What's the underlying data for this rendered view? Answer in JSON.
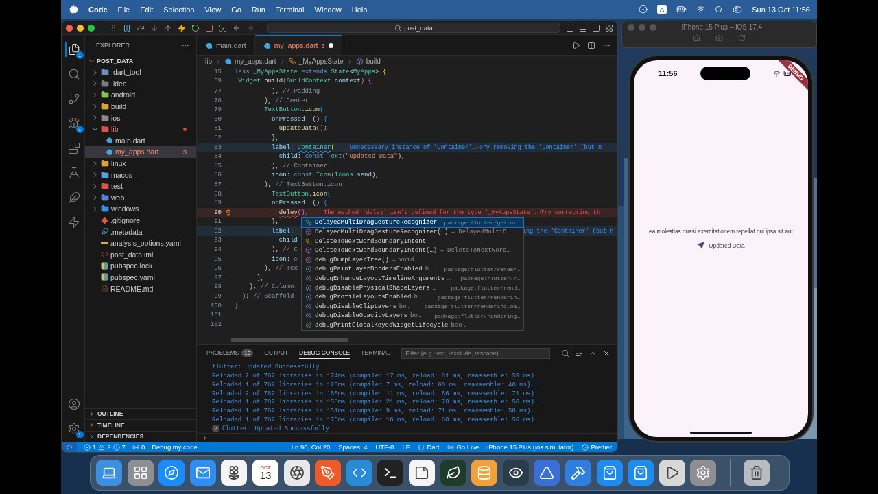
{
  "menubar": {
    "app_name": "Code",
    "menus": [
      "File",
      "Edit",
      "Selection",
      "View",
      "Go",
      "Run",
      "Terminal",
      "Window",
      "Help"
    ],
    "input_source": "A",
    "clock": "Sun 13 Oct 11:56"
  },
  "vscode": {
    "search": "post_data",
    "activity": [
      {
        "kind": "files",
        "badge": "1",
        "selected": true
      },
      {
        "kind": "search",
        "selected": false
      },
      {
        "kind": "source-control",
        "selected": false
      },
      {
        "kind": "run-debug",
        "badge": "1",
        "selected": false
      },
      {
        "kind": "extensions",
        "selected": false
      },
      {
        "kind": "testing",
        "selected": false
      },
      {
        "kind": "flutter",
        "selected": false
      },
      {
        "kind": "lightning",
        "selected": false
      }
    ],
    "activity_bottom": [
      {
        "kind": "account"
      },
      {
        "kind": "settings",
        "badge": "1"
      }
    ],
    "sidebar": {
      "title": "EXPLORER",
      "root": "POST_DATA",
      "tree": [
        {
          "label": ".dart_tool",
          "kind": "folder",
          "color": "#6d8fb3",
          "expanded": false,
          "selected": false
        },
        {
          "label": ".idea",
          "kind": "folder",
          "color": "#7b7b7b",
          "expanded": false,
          "selected": false
        },
        {
          "label": "android",
          "kind": "folder",
          "color": "#8bc34a",
          "expanded": false,
          "selected": false
        },
        {
          "label": "build",
          "kind": "folder",
          "color": "#e0a030",
          "expanded": false,
          "selected": false
        },
        {
          "label": "ios",
          "kind": "folder",
          "color": "#8a8a8a",
          "expanded": false,
          "selected": false
        },
        {
          "label": "lib",
          "kind": "folder",
          "color": "#e05050",
          "expanded": true,
          "error": true,
          "selected": false,
          "children": [
            {
              "label": "main.dart",
              "kind": "dart",
              "selected": false
            },
            {
              "label": "my_apps.dart",
              "kind": "dart",
              "error": true,
              "badge": "3",
              "selected": true
            }
          ]
        },
        {
          "label": "linux",
          "kind": "folder",
          "color": "#e0a030",
          "expanded": false,
          "selected": false
        },
        {
          "label": "macos",
          "kind": "folder",
          "color": "#5a9fd6",
          "expanded": false,
          "selected": false
        },
        {
          "label": "test",
          "kind": "folder",
          "color": "#e05050",
          "expanded": false,
          "selected": false
        },
        {
          "label": "web",
          "kind": "folder",
          "color": "#5a7fd6",
          "expanded": false,
          "selected": false
        },
        {
          "label": "windows",
          "kind": "folder",
          "color": "#3a8ee6",
          "expanded": false,
          "selected": false
        },
        {
          "label": ".gitignore",
          "kind": "git",
          "selected": false
        },
        {
          "label": ".metadata",
          "kind": "flutter",
          "selected": false
        },
        {
          "label": "analysis_options.yaml",
          "kind": "yaml",
          "selected": false
        },
        {
          "label": "post_data.iml",
          "kind": "xml",
          "selected": false
        },
        {
          "label": "pubspec.lock",
          "kind": "pubspec",
          "selected": false
        },
        {
          "label": "pubspec.yaml",
          "kind": "pubspec",
          "selected": false
        },
        {
          "label": "README.md",
          "kind": "markdown",
          "selected": false
        }
      ],
      "sections": [
        "OUTLINE",
        "TIMELINE",
        "DEPENDENCIES"
      ]
    },
    "editor": {
      "tabs": [
        {
          "label": "main.dart",
          "selected": false,
          "modified": false,
          "error": false
        },
        {
          "label": "my_apps.dart",
          "badge": "3",
          "selected": true,
          "modified": true,
          "error": true
        }
      ],
      "breadcrumb": [
        {
          "label": "lib",
          "kind": "folder"
        },
        {
          "label": "my_apps.dart",
          "kind": "dart"
        },
        {
          "label": "_MyAppsState",
          "kind": "class"
        },
        {
          "label": "build",
          "kind": "method"
        }
      ],
      "sticky_lines": [
        {
          "number": "15",
          "segments": [
            {
              "text": "lass",
              "kind": "kw"
            },
            {
              "text": " _MyAppsState ",
              "kind": "type"
            },
            {
              "text": "extends",
              "kind": "kw"
            },
            {
              "text": " State",
              "kind": "type"
            },
            {
              "text": "<",
              "kind": "plain"
            },
            {
              "text": "MyApps",
              "kind": "type"
            },
            {
              "text": "> ",
              "kind": "plain"
            },
            {
              "text": "{",
              "kind": "b1"
            }
          ]
        },
        {
          "number": "69",
          "segments": [
            {
              "text": " Widget ",
              "kind": "type"
            },
            {
              "text": "build",
              "kind": "fn"
            },
            {
              "text": "(",
              "kind": "b2"
            },
            {
              "text": "BuildContext ",
              "kind": "type"
            },
            {
              "text": "context",
              "kind": "prop"
            },
            {
              "text": ") {",
              "kind": "b2"
            }
          ]
        }
      ],
      "lines": [
        {
          "number": "77",
          "segments": [
            {
              "text": "          ), ",
              "kind": "plain"
            },
            {
              "text": "// Padding",
              "kind": "comment"
            }
          ]
        },
        {
          "number": "78",
          "segments": [
            {
              "text": "        ), ",
              "kind": "plain"
            },
            {
              "text": "// Center",
              "kind": "comment"
            }
          ]
        },
        {
          "number": "79",
          "segments": [
            {
              "text": "        TextButton",
              "kind": "type"
            },
            {
              "text": ".",
              "kind": "plain"
            },
            {
              "text": "icon",
              "kind": "fn"
            },
            {
              "text": "(",
              "kind": "b3"
            }
          ]
        },
        {
          "number": "80",
          "segments": [
            {
              "text": "          onPressed",
              "kind": "prop"
            },
            {
              "text": ": () ",
              "kind": "plain"
            },
            {
              "text": "{",
              "kind": "b3"
            }
          ]
        },
        {
          "number": "81",
          "segments": [
            {
              "text": "            updateData",
              "kind": "fn"
            },
            {
              "text": "()",
              "kind": "b2"
            },
            {
              "text": ";",
              "kind": "plain"
            }
          ]
        },
        {
          "number": "82",
          "segments": [
            {
              "text": "          },",
              "kind": "plain"
            }
          ]
        },
        {
          "number": "83",
          "segments": [
            {
              "text": "          label",
              "kind": "prop"
            },
            {
              "text": ": ",
              "kind": "plain"
            },
            {
              "text": "Container",
              "kind": "info_type"
            },
            {
              "text": "(",
              "kind": "b1"
            }
          ],
          "diagnostic": {
            "error": false,
            "text": "Unnecessary instance of 'Container'.↵Try removing the 'Container' (but n",
            "continued": false
          }
        },
        {
          "number": "84",
          "segments": [
            {
              "text": "            child",
              "kind": "prop"
            },
            {
              "text": ": ",
              "kind": "plain"
            },
            {
              "text": "const ",
              "kind": "kw"
            },
            {
              "text": "Text",
              "kind": "type"
            },
            {
              "text": "(",
              "kind": "b2"
            },
            {
              "text": "\"Updated Data\"",
              "kind": "str"
            },
            {
              "text": "),",
              "kind": "plain"
            }
          ]
        },
        {
          "number": "85",
          "segments": [
            {
              "text": "          ), ",
              "kind": "plain"
            },
            {
              "text": "// Container",
              "kind": "comment"
            }
          ]
        },
        {
          "number": "86",
          "segments": [
            {
              "text": "          icon",
              "kind": "prop"
            },
            {
              "text": ": ",
              "kind": "plain"
            },
            {
              "text": "const ",
              "kind": "kw"
            },
            {
              "text": "Icon",
              "kind": "type"
            },
            {
              "text": "(",
              "kind": "b2"
            },
            {
              "text": "Icons",
              "kind": "type"
            },
            {
              "text": ".",
              "kind": "plain"
            },
            {
              "text": "send",
              "kind": "prop"
            },
            {
              "text": "),",
              "kind": "plain"
            }
          ]
        },
        {
          "number": "87",
          "segments": [
            {
              "text": "        ), ",
              "kind": "plain"
            },
            {
              "text": "// TextButton.icon",
              "kind": "comment"
            }
          ]
        },
        {
          "number": "88",
          "segments": [
            {
              "text": "          TextButton",
              "kind": "type"
            },
            {
              "text": ".",
              "kind": "plain"
            },
            {
              "text": "icon",
              "kind": "fn"
            },
            {
              "text": "(",
              "kind": "b3"
            }
          ]
        },
        {
          "number": "89",
          "segments": [
            {
              "text": "          onPressed",
              "kind": "prop"
            },
            {
              "text": ": () ",
              "kind": "plain"
            },
            {
              "text": "{",
              "kind": "b3"
            }
          ]
        },
        {
          "number": "90",
          "lightbulb": true,
          "current": true,
          "segments": [
            {
              "text": "            deley",
              "kind": "error_fn"
            },
            {
              "text": "()",
              "kind": "b2"
            },
            {
              "text": ";",
              "kind": "plain"
            }
          ],
          "diagnostic": {
            "error": true,
            "text": "The method 'deley' isn't defined for the type '_MyAppsState'.↵Try correcting th",
            "continued": false
          }
        },
        {
          "number": "91",
          "segments": [
            {
              "text": "          },",
              "kind": "plain"
            }
          ]
        },
        {
          "number": "92",
          "segments": [
            {
              "text": "          label",
              "kind": "prop"
            },
            {
              "text": ": ",
              "kind": "plain"
            }
          ],
          "diagnostic": {
            "error": false,
            "text": "ing the 'Container' (but n",
            "continued": true
          }
        },
        {
          "number": "93",
          "segments": [
            {
              "text": "            child",
              "kind": "prop"
            }
          ]
        },
        {
          "number": "94",
          "segments": [
            {
              "text": "          ), ",
              "kind": "plain"
            },
            {
              "text": "// C",
              "kind": "comment"
            }
          ]
        },
        {
          "number": "95",
          "segments": [
            {
              "text": "          icon",
              "kind": "prop"
            },
            {
              "text": ": ",
              "kind": "plain"
            },
            {
              "text": "c",
              "kind": "kw"
            }
          ]
        },
        {
          "number": "96",
          "segments": [
            {
              "text": "        ), ",
              "kind": "plain"
            },
            {
              "text": "// Tex",
              "kind": "comment"
            }
          ]
        },
        {
          "number": "97",
          "segments": [
            {
              "text": "      ],",
              "kind": "plain"
            }
          ]
        },
        {
          "number": "98",
          "segments": [
            {
              "text": "    ), ",
              "kind": "plain"
            },
            {
              "text": "// Column",
              "kind": "comment"
            }
          ]
        },
        {
          "number": "99",
          "segments": [
            {
              "text": "  ); ",
              "kind": "plain"
            },
            {
              "text": "// Scaffold",
              "kind": "comment"
            }
          ]
        },
        {
          "number": "100",
          "segments": [
            {
              "text": "}",
              "kind": "b2"
            }
          ]
        },
        {
          "number": "101"
        },
        {
          "number": "102"
        }
      ],
      "suggestions": [
        {
          "kind": "class",
          "label": "DelayedMultiDragGestureRecognizer",
          "source": "package:flutter/gestur…",
          "selected": true
        },
        {
          "kind": "method",
          "label": "DelayedMultiDragGestureRecognizer(…)",
          "type": "→ DelayedMultiD…",
          "selected": false
        },
        {
          "kind": "class",
          "label": "DeleteToNextWordBoundaryIntent",
          "selected": false
        },
        {
          "kind": "method",
          "label": "DeleteToNextWordBoundaryIntent(…)",
          "type": "→ DeleteToNextWord…",
          "selected": false
        },
        {
          "kind": "method",
          "label": "debugDumpLayerTree()",
          "type": "→ void",
          "selected": false
        },
        {
          "kind": "field",
          "label": "debugPaintLayerBordersEnabled",
          "type": "b…",
          "source": "package:flutter/render…",
          "selected": false
        },
        {
          "kind": "field",
          "label": "debugEnhanceLayoutTimelineArguments",
          "type": "…",
          "source": "package:flutter/r…",
          "selected": false
        },
        {
          "kind": "field",
          "label": "debugDisablePhysicalShapeLayers",
          "type": "…",
          "source": "package:flutter/rend…",
          "selected": false
        },
        {
          "kind": "field",
          "label": "debugProfileLayoutsEnabled",
          "type": "b…",
          "source": "package:flutter/renderin…",
          "selected": false
        },
        {
          "kind": "field",
          "label": "debugDisableClipLayers",
          "type": "bo…",
          "source": "package:flutter/rendering.da…",
          "selected": false
        },
        {
          "kind": "field",
          "label": "debugDisableOpacityLayers",
          "type": "bo…",
          "source": "package:flutter/rendering…",
          "selected": false
        },
        {
          "kind": "field",
          "label": "debugPrintGlobalKeyedWidgetLifecycle",
          "type": "bool",
          "selected": false
        }
      ]
    },
    "panel": {
      "tabs": [
        {
          "label": "PROBLEMS",
          "badge": "10",
          "selected": false
        },
        {
          "label": "OUTPUT",
          "selected": false
        },
        {
          "label": "DEBUG CONSOLE",
          "selected": true
        },
        {
          "label": "TERMINAL",
          "selected": false
        }
      ],
      "filter_placeholder": "Filter (e.g. text, !exclude, \\escape)",
      "console": [
        {
          "text": "flutter: Updated Successfully"
        },
        {
          "text": "Reloaded 2 of 782 libraries in 174ms (compile: 17 ms, reload: 81 ms, reassemble: 59 ms)."
        },
        {
          "text": "Reloaded 1 of 782 libraries in 126ms (compile: 7 ms, reload: 60 ms, reassemble: 48 ms)."
        },
        {
          "text": "Reloaded 2 of 782 libraries in 160ms (compile: 11 ms, reload: 66 ms, reassemble: 71 ms)."
        },
        {
          "text": "Reloaded 1 of 782 libraries in 158ms (compile: 21 ms, reload: 70 ms, reassemble: 56 ms)."
        },
        {
          "text": "Reloaded 1 of 782 libraries in 151ms (compile: 9 ms, reload: 71 ms, reassemble: 58 ms)."
        },
        {
          "text": "Reloaded 1 of 782 libraries in 175ms (compile: 16 ms, reload: 80 ms, reassemble: 56 ms)."
        },
        {
          "text": "flutter: Updated Successfully",
          "count": "2"
        }
      ]
    },
    "status_bar": {
      "errors": "1",
      "warnings": "2",
      "infos": "7",
      "ports": "0",
      "debug": "Debug my code",
      "items": [
        {
          "label": "Ln 90, Col 20",
          "kind": "plain"
        },
        {
          "label": "Spaces: 4",
          "kind": "plain"
        },
        {
          "label": "UTF-8",
          "kind": "plain"
        },
        {
          "label": "LF",
          "kind": "plain"
        },
        {
          "label": "Dart",
          "kind": "braces"
        },
        {
          "label": "Go Live",
          "kind": "broadcast"
        },
        {
          "label": "iPhone 15 Plus (ios simulator)",
          "kind": "plain"
        },
        {
          "label": "Prettier",
          "kind": "ban"
        }
      ]
    }
  },
  "simulator": {
    "title": "iPhone 15 Plus – iOS 17.4",
    "time": "11:56",
    "banner": "DEBUG",
    "text": "ea molestias quasi exercitationem repellat qui ipsa sit aut",
    "button": "Updated Data"
  },
  "dock": [
    {
      "kind": "laptop",
      "color": "#3d8fe0"
    },
    {
      "kind": "grid",
      "color": "#8e8e93"
    },
    {
      "kind": "compass",
      "color": "#1a8cff"
    },
    {
      "kind": "mail",
      "color": "#2f8ef5"
    },
    {
      "kind": "flower",
      "color": "#f4f4f4"
    },
    {
      "kind": "calendar",
      "color": "#ffffff",
      "month": "OCT",
      "day": "13"
    },
    {
      "kind": "aperture",
      "color": "#e8e8e8"
    },
    {
      "kind": "pen",
      "color": "#f05a28"
    },
    {
      "kind": "code",
      "color": "#2a8ad8"
    },
    {
      "kind": "terminal",
      "color": "#222222"
    },
    {
      "kind": "note",
      "color": "#f5f5f5"
    },
    {
      "kind": "leaf",
      "color": "#1e3b2b"
    },
    {
      "kind": "database",
      "color": "#f2a13a"
    },
    {
      "kind": "eye",
      "color": "#2b3c4a"
    },
    {
      "kind": "triangle",
      "color": "#3a6fd8"
    },
    {
      "kind": "hammer",
      "color": "#2f7fe0"
    },
    {
      "kind": "bag",
      "color": "#1d8bf0"
    },
    {
      "kind": "bag",
      "color": "#1d8bf0"
    },
    {
      "kind": "play",
      "color": "#d8d8d8"
    },
    {
      "kind": "gear",
      "color": "#8e8e93"
    },
    {
      "kind": "trash",
      "color": "#b8bcc2"
    }
  ]
}
